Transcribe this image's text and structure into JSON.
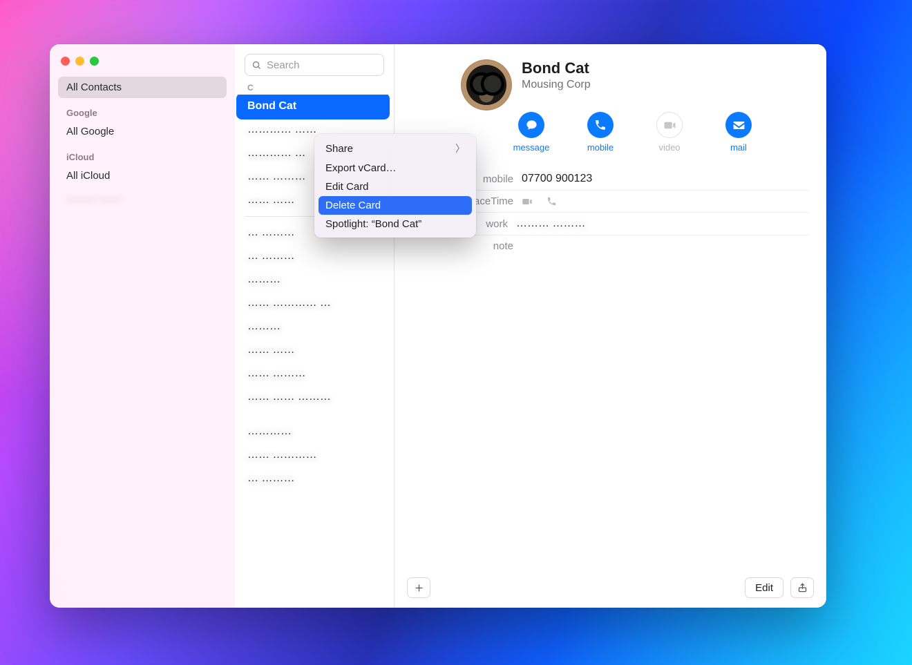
{
  "sidebar": {
    "all_contacts": "All Contacts",
    "groups": [
      {
        "header": "Google",
        "items": [
          "All Google"
        ]
      },
      {
        "header": "iCloud",
        "items": [
          "All iCloud",
          "……… ……"
        ]
      }
    ]
  },
  "search": {
    "placeholder": "Search"
  },
  "list": {
    "section_letter": "C",
    "selected": "Bond Cat",
    "rows_blurred": [
      "………… ……",
      "………… …",
      "…… ………",
      "…… ……",
      "",
      "… ………",
      "…  ………",
      "………",
      "…… ………… …",
      "………",
      "…… ……",
      "…… ………",
      "…… …… ………",
      "",
      "…………",
      "…… …………",
      "… ………"
    ]
  },
  "context_menu": {
    "items": [
      {
        "label": "Share",
        "submenu": true,
        "highlight": false
      },
      {
        "label": "Export vCard…",
        "submenu": false,
        "highlight": false
      },
      {
        "label": "Edit Card",
        "submenu": false,
        "highlight": false
      },
      {
        "label": "Delete Card",
        "submenu": false,
        "highlight": true
      },
      {
        "label": "Spotlight: “Bond Cat”",
        "submenu": false,
        "highlight": false
      }
    ]
  },
  "card": {
    "name": "Bond Cat",
    "org": "Mousing Corp",
    "actions": {
      "message": "message",
      "mobile": "mobile",
      "video": "video",
      "mail": "mail"
    },
    "fields": {
      "mobile_label": "mobile",
      "mobile_value": "07700 900123",
      "facetime_label": "FaceTime",
      "work_label": "work",
      "work_value": "……… ………",
      "note_label": "note"
    },
    "footer": {
      "edit": "Edit"
    }
  }
}
